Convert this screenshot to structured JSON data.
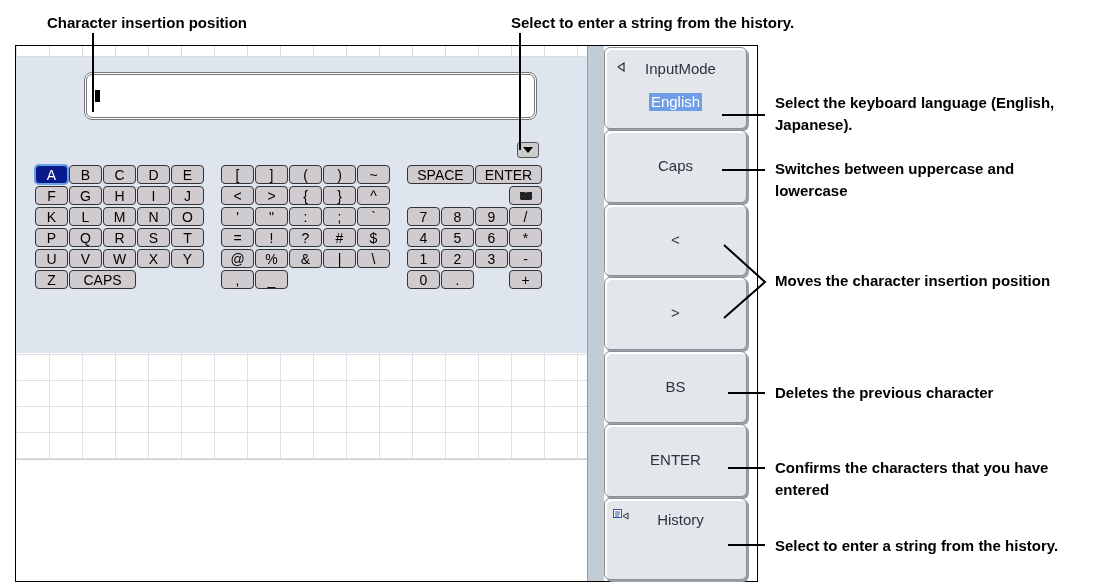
{
  "annotations": {
    "top": [
      {
        "text": "Character insertion position"
      },
      {
        "text": "Select to enter a string from the history."
      }
    ],
    "right": [
      {
        "text": "Select the keyboard language (English, Japanese)."
      },
      {
        "text": "Switches between uppercase and lowercase"
      },
      {
        "text": "Moves the character insertion position"
      },
      {
        "text": "Deletes the previous character"
      },
      {
        "text": "Confirms the characters that you have entered"
      },
      {
        "text": "Select to enter a string from the history."
      }
    ]
  },
  "keyboard": {
    "groups": [
      {
        "rows": [
          [
            {
              "kind": "key",
              "label": "A",
              "selected": true
            },
            {
              "kind": "key",
              "label": "B",
              "selected": false
            },
            {
              "kind": "key",
              "label": "C",
              "selected": false
            },
            {
              "kind": "key",
              "label": "D",
              "selected": false
            },
            {
              "kind": "key",
              "label": "E",
              "selected": false
            }
          ],
          [
            {
              "kind": "key",
              "label": "F",
              "selected": false
            },
            {
              "kind": "key",
              "label": "G",
              "selected": false
            },
            {
              "kind": "key",
              "label": "H",
              "selected": false
            },
            {
              "kind": "key",
              "label": "I",
              "selected": false
            },
            {
              "kind": "key",
              "label": "J",
              "selected": false
            }
          ],
          [
            {
              "kind": "key",
              "label": "K",
              "selected": false
            },
            {
              "kind": "key",
              "label": "L",
              "selected": false
            },
            {
              "kind": "key",
              "label": "M",
              "selected": false
            },
            {
              "kind": "key",
              "label": "N",
              "selected": false
            },
            {
              "kind": "key",
              "label": "O",
              "selected": false
            }
          ],
          [
            {
              "kind": "key",
              "label": "P",
              "selected": false
            },
            {
              "kind": "key",
              "label": "Q",
              "selected": false
            },
            {
              "kind": "key",
              "label": "R",
              "selected": false
            },
            {
              "kind": "key",
              "label": "S",
              "selected": false
            },
            {
              "kind": "key",
              "label": "T",
              "selected": false
            }
          ],
          [
            {
              "kind": "key",
              "label": "U",
              "selected": false
            },
            {
              "kind": "key",
              "label": "V",
              "selected": false
            },
            {
              "kind": "key",
              "label": "W",
              "selected": false
            },
            {
              "kind": "key",
              "label": "X",
              "selected": false
            },
            {
              "kind": "key",
              "label": "Y",
              "selected": false
            }
          ],
          [
            {
              "kind": "key",
              "label": "Z",
              "selected": false
            },
            {
              "kind": "wide",
              "label": "CAPS",
              "selected": false
            },
            {
              "kind": "span"
            }
          ]
        ]
      },
      {
        "rows": [
          [
            {
              "kind": "key",
              "label": "[",
              "selected": false
            },
            {
              "kind": "key",
              "label": "]",
              "selected": false
            },
            {
              "kind": "key",
              "label": "(",
              "selected": false
            },
            {
              "kind": "key",
              "label": ")",
              "selected": false
            },
            {
              "kind": "key",
              "label": "~",
              "selected": false
            }
          ],
          [
            {
              "kind": "key",
              "label": "<",
              "selected": false
            },
            {
              "kind": "key",
              "label": ">",
              "selected": false
            },
            {
              "kind": "key",
              "label": "{",
              "selected": false
            },
            {
              "kind": "key",
              "label": "}",
              "selected": false
            },
            {
              "kind": "key",
              "label": "^",
              "selected": false
            }
          ],
          [
            {
              "kind": "key",
              "label": "'",
              "selected": false
            },
            {
              "kind": "key",
              "label": "\"",
              "selected": false
            },
            {
              "kind": "key",
              "label": ":",
              "selected": false
            },
            {
              "kind": "key",
              "label": ";",
              "selected": false
            },
            {
              "kind": "key",
              "label": "`",
              "selected": false
            }
          ],
          [
            {
              "kind": "key",
              "label": "=",
              "selected": false
            },
            {
              "kind": "key",
              "label": "!",
              "selected": false
            },
            {
              "kind": "key",
              "label": "?",
              "selected": false
            },
            {
              "kind": "key",
              "label": "#",
              "selected": false
            },
            {
              "kind": "key",
              "label": "$",
              "selected": false
            }
          ],
          [
            {
              "kind": "key",
              "label": "@",
              "selected": false
            },
            {
              "kind": "key",
              "label": "%",
              "selected": false
            },
            {
              "kind": "key",
              "label": "&",
              "selected": false
            },
            {
              "kind": "key",
              "label": "|",
              "selected": false
            },
            {
              "kind": "key",
              "label": "\\",
              "selected": false
            }
          ],
          [
            {
              "kind": "key",
              "label": ",",
              "selected": false
            },
            {
              "kind": "key",
              "label": "_",
              "selected": false
            }
          ]
        ]
      },
      {
        "rows": [
          [
            {
              "kind": "wide",
              "label": "SPACE",
              "selected": false
            },
            {
              "kind": "span"
            },
            {
              "kind": "wide",
              "label": "ENTER",
              "selected": false
            },
            {
              "kind": "span"
            }
          ],
          [
            {
              "kind": "gap"
            },
            {
              "kind": "gap"
            },
            {
              "kind": "gap"
            },
            {
              "kind": "icon",
              "selected": false
            }
          ],
          [
            {
              "kind": "key",
              "label": "7",
              "selected": false
            },
            {
              "kind": "key",
              "label": "8",
              "selected": false
            },
            {
              "kind": "key",
              "label": "9",
              "selected": false
            },
            {
              "kind": "key",
              "label": "/",
              "selected": false
            }
          ],
          [
            {
              "kind": "key",
              "label": "4",
              "selected": false
            },
            {
              "kind": "key",
              "label": "5",
              "selected": false
            },
            {
              "kind": "key",
              "label": "6",
              "selected": false
            },
            {
              "kind": "key",
              "label": "*",
              "selected": false
            }
          ],
          [
            {
              "kind": "key",
              "label": "1",
              "selected": false
            },
            {
              "kind": "key",
              "label": "2",
              "selected": false
            },
            {
              "kind": "key",
              "label": "3",
              "selected": false
            },
            {
              "kind": "key",
              "label": "-",
              "selected": false
            }
          ],
          [
            {
              "kind": "key",
              "label": "0",
              "selected": false
            },
            {
              "kind": "key",
              "label": ".",
              "selected": false
            },
            {
              "kind": "gap"
            },
            {
              "kind": "key",
              "label": "+",
              "selected": false
            }
          ]
        ]
      }
    ]
  },
  "softkeys": [
    {
      "kind": "select",
      "label": "InputMode",
      "value": "English"
    },
    {
      "kind": "plain",
      "label": "Caps"
    },
    {
      "kind": "plain",
      "label": "<"
    },
    {
      "kind": "plain",
      "label": ">"
    },
    {
      "kind": "plain",
      "label": "BS"
    },
    {
      "kind": "plain",
      "label": "ENTER"
    },
    {
      "kind": "menu",
      "label": "History"
    }
  ]
}
